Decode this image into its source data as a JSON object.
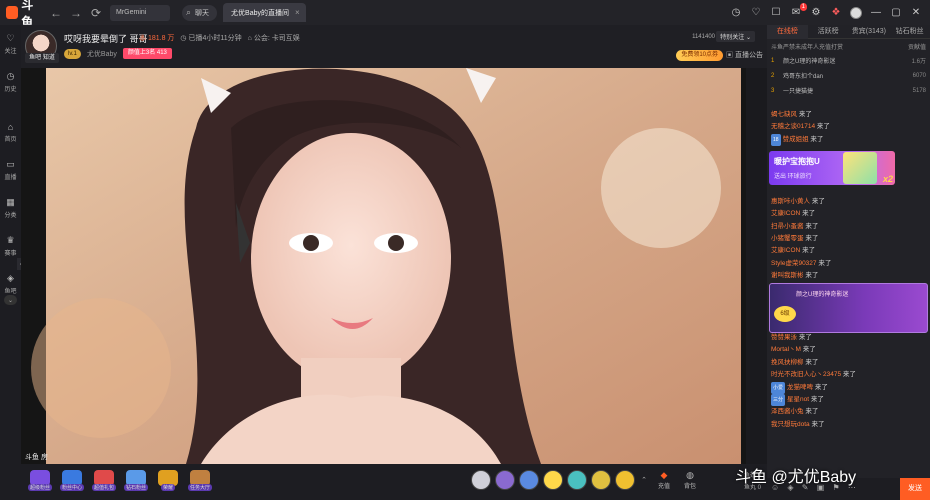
{
  "topbar": {
    "logo_text": "斗鱼",
    "search_user": "MrGemini",
    "search_tag": "聊天",
    "tab_title": "尤优Baby的直播间",
    "notify_count": "1"
  },
  "leftbar": {
    "items": [
      {
        "label": "关注",
        "icon": "heart-icon"
      },
      {
        "label": "历史",
        "icon": "clock-icon"
      },
      {
        "label": "首页",
        "icon": "home-icon"
      },
      {
        "label": "直播",
        "icon": "tv-icon"
      },
      {
        "label": "分类",
        "icon": "grid-icon"
      },
      {
        "label": "赛事",
        "icon": "trophy-icon"
      },
      {
        "label": "鱼吧",
        "icon": "fish-icon"
      }
    ]
  },
  "room": {
    "title": "哎呀我要晕倒了 哥哥",
    "hot": "181.8 万",
    "live_time": "已播4小时11分钟",
    "guild": "公会: 卡司互娱",
    "anchor_name": "尤优Baby",
    "level": "lv.1",
    "rank_text": "颜值上3名 413",
    "follow_count": "1141400",
    "follow_label": "特别关注",
    "gift_pill": "免费领10点券",
    "notice": "直播公告",
    "av_tag": "鱼吧 知道"
  },
  "video": {
    "watermark": "斗鱼 房"
  },
  "giftbar": {
    "left_items": [
      {
        "label": "超级粉丝",
        "color": "#7a4ee0"
      },
      {
        "label": "粉丝中心",
        "color": "#3a7ae0"
      },
      {
        "label": "超值礼包",
        "color": "#e04a4a"
      },
      {
        "label": "钻石粉丝",
        "color": "#5a9ae8"
      },
      {
        "label": "荣耀",
        "color": "#e0a020"
      },
      {
        "label": "任务大厅",
        "color": "#c08040"
      }
    ],
    "gifts": [
      "#d0d0d8",
      "#8a6ad0",
      "#5a8ae0",
      "#ffd84a",
      "#4ac0c0",
      "#e0c040",
      "#f0c030"
    ],
    "btn_charge": "充值",
    "btn_bag": "背包",
    "stats_gold_label": "鱼翅",
    "stats_gold": "0",
    "stats_fish_label": "鱼丸",
    "stats_fish": "0"
  },
  "right": {
    "tabs": [
      {
        "label": "在线榜",
        "active": true
      },
      {
        "label": "活跃榜",
        "active": false
      },
      {
        "label": "贵宾(3143)",
        "active": false
      },
      {
        "label": "钻石粉丝",
        "active": false
      }
    ],
    "rank_note": "斗鱼严禁未成年人充值打赏",
    "rank_note_right": "贡献值",
    "ranking": [
      {
        "n": "1",
        "name": "颜之U理的神奇影迷",
        "v": "1.6万"
      },
      {
        "n": "2",
        "name": "鸡哥东扣个dan",
        "v": "6070"
      },
      {
        "n": "3",
        "name": "一只捷猫捷",
        "v": "5178"
      }
    ],
    "chat": [
      {
        "u": "蝎七缺风",
        "t": "来了",
        "badge": ""
      },
      {
        "u": "无稽之谈01714",
        "t": "来了",
        "badge": ""
      },
      {
        "u": "赞成姐姐",
        "t": "来了",
        "badge": "18"
      },
      {
        "u": "",
        "t": "",
        "badge": ""
      },
      {
        "u": "",
        "t": "",
        "badge": ""
      },
      {
        "u": "",
        "t": "",
        "badge": ""
      },
      {
        "u": "",
        "t": "",
        "badge": ""
      },
      {
        "u": "惠斯咔小黄人",
        "t": "来了",
        "badge": ""
      },
      {
        "u": "艾康ICON",
        "t": "来了",
        "badge": ""
      },
      {
        "u": "扫帚小蚤酱",
        "t": "来了",
        "badge": ""
      },
      {
        "u": "小猪蟹零蛋",
        "t": "来了",
        "badge": ""
      },
      {
        "u": "艾康ICON",
        "t": "来了",
        "badge": ""
      },
      {
        "u": "Style虚荣90327",
        "t": "来了",
        "badge": ""
      },
      {
        "u": "谢叫我斯彬",
        "t": "来了",
        "badge": ""
      },
      {
        "u": "",
        "t": "",
        "badge": ""
      },
      {
        "u": "",
        "t": "",
        "badge": ""
      },
      {
        "u": "",
        "t": "",
        "badge": ""
      },
      {
        "u": "",
        "t": "",
        "badge": ""
      },
      {
        "u": "赞赞果泳",
        "t": "来了",
        "badge": ""
      },
      {
        "u": "Mortal丶M",
        "t": "来了",
        "badge": ""
      },
      {
        "u": "挽风扶柳柳",
        "t": "来了",
        "badge": ""
      },
      {
        "u": "时光不改旧人心丶23475",
        "t": "来了",
        "badge": ""
      },
      {
        "u": "龙猫啤啤",
        "t": "来了",
        "badge": "小爱"
      },
      {
        "u": "星星not",
        "t": "来了",
        "badge": "三分"
      },
      {
        "u": "泽西酱小兔",
        "t": "来了",
        "badge": ""
      },
      {
        "u": "我只想玩dota",
        "t": "来了",
        "badge": ""
      }
    ],
    "banner1_title": "暖护宝抱抱U",
    "banner1_sub": "送出  环球旅行",
    "banner1_mult": "x2",
    "banner2_text": "颜之U理的神奇影迷",
    "banner2_level": "6级",
    "send_label": "发送"
  },
  "overlay": "斗鱼 @尤优Baby"
}
